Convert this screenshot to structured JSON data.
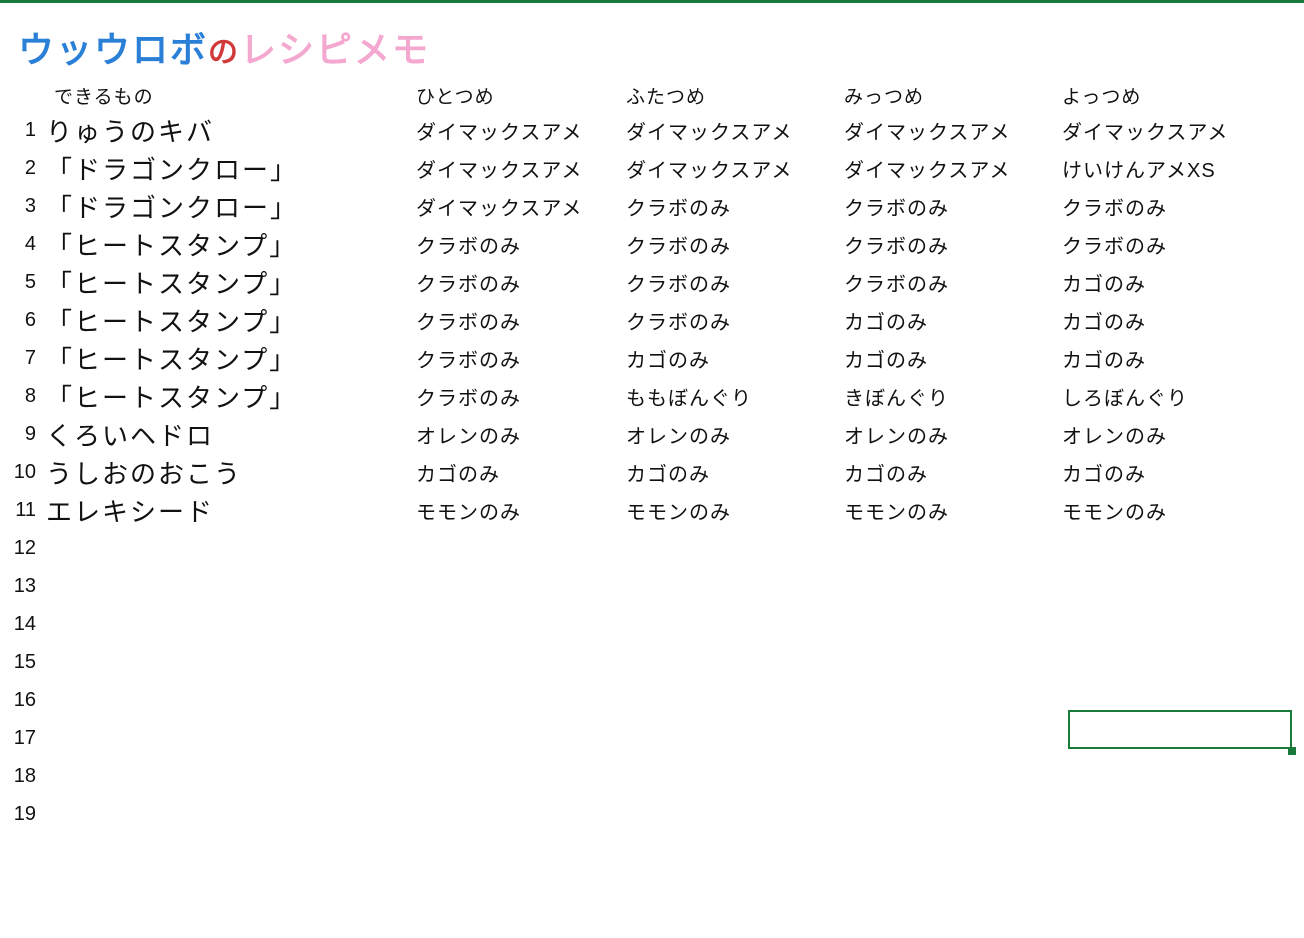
{
  "title": {
    "part1": "ウッウロボ",
    "part2": "の",
    "part3": "レシピメモ"
  },
  "headers": {
    "result": "できるもの",
    "c1": "ひとつめ",
    "c2": "ふたつめ",
    "c3": "みっつめ",
    "c4": "よっつめ"
  },
  "rows": [
    {
      "n": "1",
      "result": "りゅうのキバ",
      "c1": "ダイマックスアメ",
      "c2": "ダイマックスアメ",
      "c3": "ダイマックスアメ",
      "c4": "ダイマックスアメ"
    },
    {
      "n": "2",
      "result": "「ドラゴンクロー」",
      "c1": "ダイマックスアメ",
      "c2": "ダイマックスアメ",
      "c3": "ダイマックスアメ",
      "c4": "けいけんアメXS"
    },
    {
      "n": "3",
      "result": "「ドラゴンクロー」",
      "c1": "ダイマックスアメ",
      "c2": "クラボのみ",
      "c3": "クラボのみ",
      "c4": "クラボのみ"
    },
    {
      "n": "4",
      "result": "「ヒートスタンプ」",
      "c1": "クラボのみ",
      "c2": "クラボのみ",
      "c3": "クラボのみ",
      "c4": "クラボのみ"
    },
    {
      "n": "5",
      "result": "「ヒートスタンプ」",
      "c1": "クラボのみ",
      "c2": "クラボのみ",
      "c3": "クラボのみ",
      "c4": "カゴのみ"
    },
    {
      "n": "6",
      "result": "「ヒートスタンプ」",
      "c1": "クラボのみ",
      "c2": "クラボのみ",
      "c3": "カゴのみ",
      "c4": "カゴのみ"
    },
    {
      "n": "7",
      "result": "「ヒートスタンプ」",
      "c1": "クラボのみ",
      "c2": "カゴのみ",
      "c3": "カゴのみ",
      "c4": "カゴのみ"
    },
    {
      "n": "8",
      "result": "「ヒートスタンプ」",
      "c1": "クラボのみ",
      "c2": "ももぼんぐり",
      "c3": "きぼんぐり",
      "c4": "しろぼんぐり"
    },
    {
      "n": "9",
      "result": "くろいヘドロ",
      "c1": "オレンのみ",
      "c2": "オレンのみ",
      "c3": "オレンのみ",
      "c4": "オレンのみ"
    },
    {
      "n": "10",
      "result": "うしおのおこう",
      "c1": "カゴのみ",
      "c2": "カゴのみ",
      "c3": "カゴのみ",
      "c4": "カゴのみ"
    },
    {
      "n": "11",
      "result": "エレキシード",
      "c1": "モモンのみ",
      "c2": "モモンのみ",
      "c3": "モモンのみ",
      "c4": "モモンのみ"
    },
    {
      "n": "12",
      "result": "",
      "c1": "",
      "c2": "",
      "c3": "",
      "c4": ""
    },
    {
      "n": "13",
      "result": "",
      "c1": "",
      "c2": "",
      "c3": "",
      "c4": ""
    },
    {
      "n": "14",
      "result": "",
      "c1": "",
      "c2": "",
      "c3": "",
      "c4": ""
    },
    {
      "n": "15",
      "result": "",
      "c1": "",
      "c2": "",
      "c3": "",
      "c4": ""
    },
    {
      "n": "16",
      "result": "",
      "c1": "",
      "c2": "",
      "c3": "",
      "c4": ""
    },
    {
      "n": "17",
      "result": "",
      "c1": "",
      "c2": "",
      "c3": "",
      "c4": ""
    },
    {
      "n": "18",
      "result": "",
      "c1": "",
      "c2": "",
      "c3": "",
      "c4": ""
    },
    {
      "n": "19",
      "result": "",
      "c1": "",
      "c2": "",
      "c3": "",
      "c4": ""
    }
  ],
  "selection": {
    "row": 16,
    "col": "c4"
  }
}
